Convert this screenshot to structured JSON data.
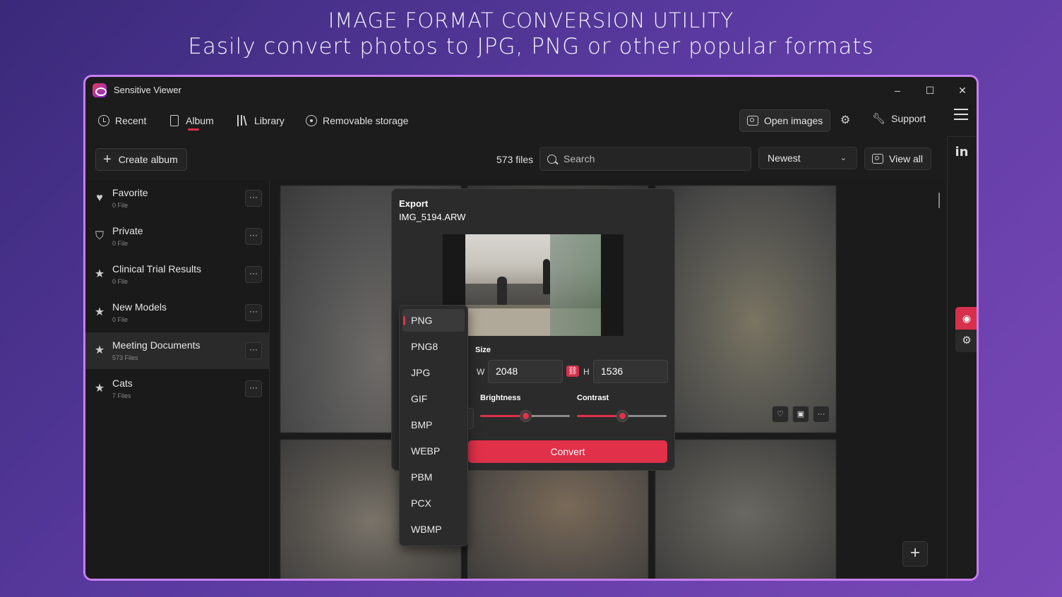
{
  "banner": {
    "line1": "IMAGE FORMAT CONVERSION UTILITY",
    "line2": "Easily convert photos to JPG, PNG or other popular formats"
  },
  "window": {
    "title": "Sensitive Viewer",
    "controls": {
      "minimize": "–",
      "maximize": "☐",
      "close": "✕"
    }
  },
  "nav": {
    "items": [
      {
        "label": "Recent",
        "icon": "clock-icon"
      },
      {
        "label": "Album",
        "icon": "album-icon",
        "active": true
      },
      {
        "label": "Library",
        "icon": "library-icon"
      },
      {
        "label": "Removable storage",
        "icon": "storage-icon"
      }
    ],
    "open_images": "Open images",
    "support": "Support"
  },
  "toolbar": {
    "create_album": "Create album",
    "file_count": "573 files",
    "search_placeholder": "Search",
    "sort": "Newest",
    "view_all": "View all"
  },
  "albums": [
    {
      "name": "Favorite",
      "count": "0 File",
      "icon": "heart-icon"
    },
    {
      "name": "Private",
      "count": "0 File",
      "icon": "shield-icon"
    },
    {
      "name": "Clinical Trial Results",
      "count": "0 File",
      "icon": "star-icon"
    },
    {
      "name": "New Models",
      "count": "0 File",
      "icon": "star-icon"
    },
    {
      "name": "Meeting Documents",
      "count": "573 Files",
      "icon": "star-icon",
      "selected": true
    },
    {
      "name": "Cats",
      "count": "7 Files",
      "icon": "star-icon"
    }
  ],
  "export": {
    "title": "Export",
    "filename": "IMG_5194.ARW",
    "size_label": "Size",
    "width_label": "W",
    "width": "2048",
    "height_label": "H",
    "height": "1536",
    "brightness_label": "Brightness",
    "brightness": 0.5,
    "contrast_label": "Contrast",
    "contrast": 0.5,
    "convert": "Convert"
  },
  "formats": {
    "options": [
      "PNG",
      "PNG8",
      "JPG",
      "GIF",
      "BMP",
      "WEBP",
      "PBM",
      "PCX",
      "WBMP"
    ],
    "selected": "PNG"
  },
  "colors": {
    "accent": "#e0304a",
    "window_border": "#c77ff0",
    "background": "#1c1c1c"
  }
}
